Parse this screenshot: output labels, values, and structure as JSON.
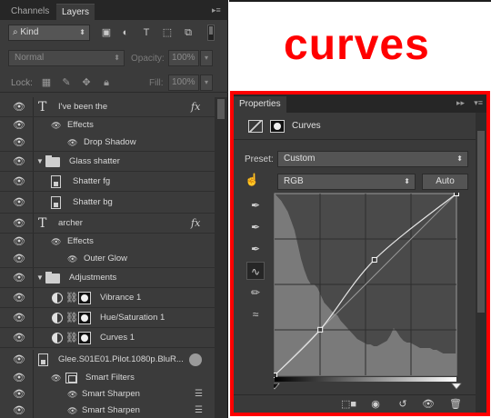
{
  "layers_panel": {
    "tabs": [
      "Channels",
      "Layers"
    ],
    "active_tab": "Layers",
    "filter": {
      "kind_label": "Kind"
    },
    "blend_mode": "Normal",
    "opacity_label": "Opacity:",
    "opacity_value": "100%",
    "lock_label": "Lock:",
    "fill_label": "Fill:",
    "fill_value": "100%",
    "rows": [
      {
        "label": "I've been the"
      },
      {
        "label": "Effects"
      },
      {
        "label": "Drop Shadow"
      },
      {
        "label": "Glass shatter"
      },
      {
        "label": "Shatter fg"
      },
      {
        "label": "Shatter bg"
      },
      {
        "label": "archer"
      },
      {
        "label": "Effects"
      },
      {
        "label": "Outer Glow"
      },
      {
        "label": "Adjustments"
      },
      {
        "label": "Vibrance 1"
      },
      {
        "label": "Hue/Saturation 1"
      },
      {
        "label": "Curves 1"
      },
      {
        "label": "Glee.S01E01.Pilot.1080p.BluR..."
      },
      {
        "label": "Smart Filters"
      },
      {
        "label": "Smart Sharpen"
      },
      {
        "label": "Smart Sharpen"
      }
    ]
  },
  "annotation": {
    "text": "curves",
    "color": "#ff0000"
  },
  "properties_panel": {
    "tab_label": "Properties",
    "adjustment_name": "Curves",
    "preset_label": "Preset:",
    "preset_value": "Custom",
    "channel_value": "RGB",
    "auto_button": "Auto",
    "curve_points": [
      [
        0,
        0
      ],
      [
        64,
        64
      ],
      [
        140,
        162
      ],
      [
        255,
        255
      ]
    ],
    "histogram": [
      100,
      98,
      96,
      93,
      90,
      85,
      80,
      72,
      64,
      58,
      53,
      50,
      50,
      48,
      44,
      40,
      38,
      36,
      34,
      33,
      30,
      28,
      26,
      24,
      22,
      20,
      19,
      18,
      17,
      17,
      16,
      16,
      17,
      18,
      19,
      22,
      26,
      24,
      21,
      19,
      18,
      18,
      17,
      16,
      15,
      15,
      15,
      15,
      14,
      14,
      13,
      12,
      12,
      12,
      12,
      12
    ]
  }
}
